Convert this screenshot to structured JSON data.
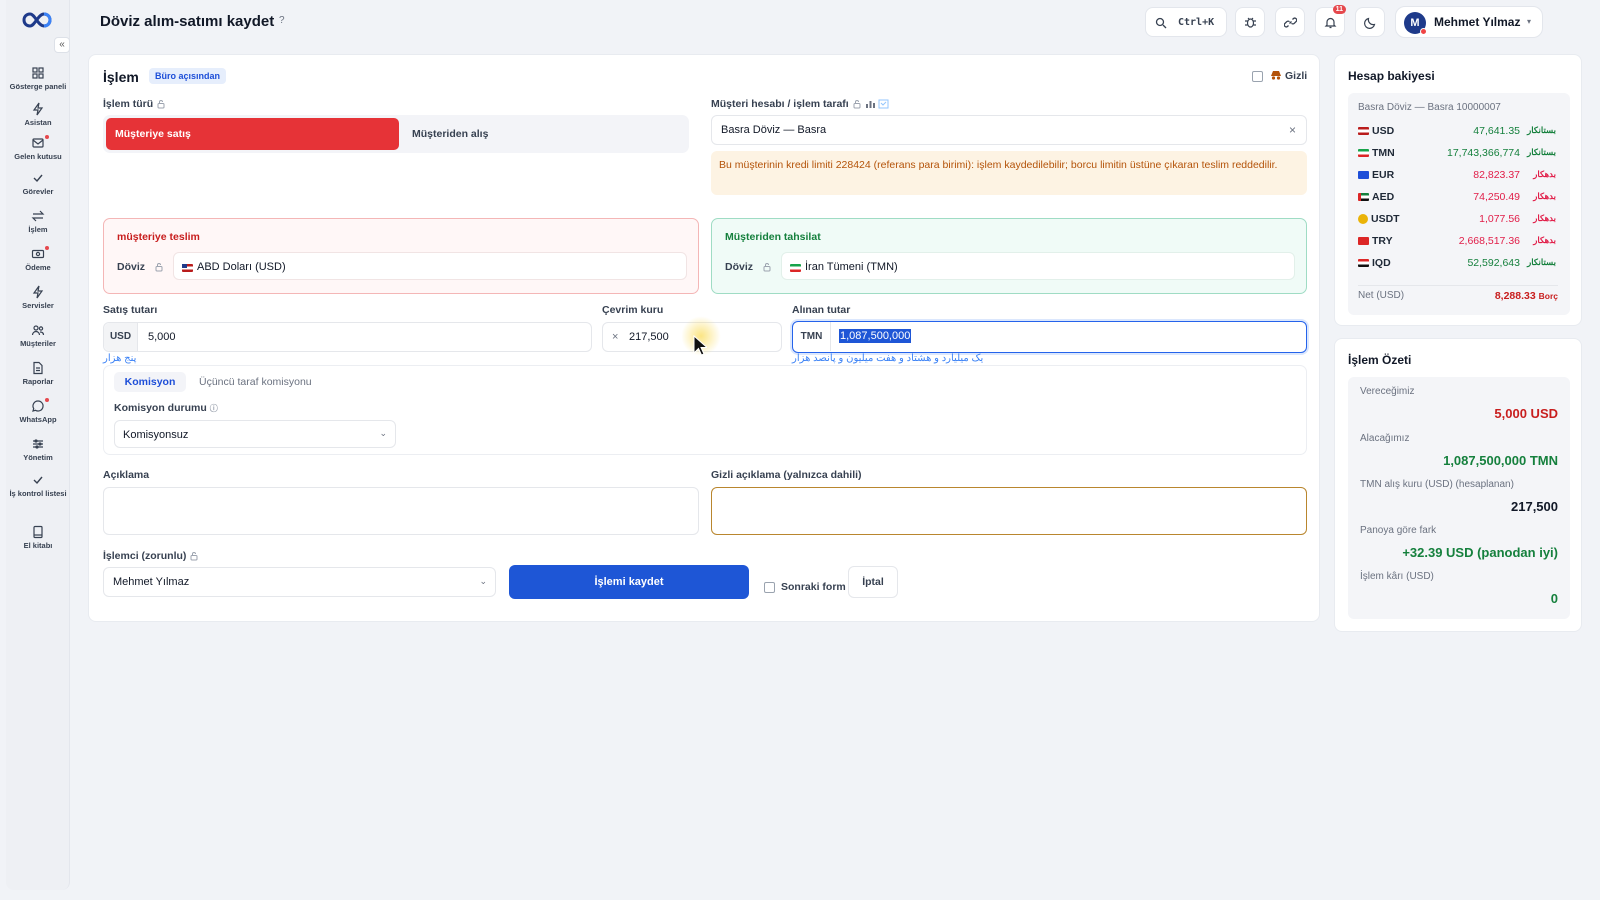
{
  "header": {
    "title": "Döviz alım-satımı kaydet",
    "info_icon": "?",
    "search_shortcut": "Ctrl+K",
    "notifications_count": "11",
    "user_name": "Mehmet Yılmaz",
    "user_initial": "M"
  },
  "sidebar": {
    "collapse": "«",
    "items": [
      {
        "label": "Gösterge paneli",
        "icon": "grid-icon"
      },
      {
        "label": "Asistan",
        "icon": "bolt-icon"
      },
      {
        "label": "Gelen kutusu",
        "icon": "inbox-icon"
      },
      {
        "label": "Görevler",
        "icon": "check-icon"
      },
      {
        "label": "İşlem",
        "icon": "swap-icon"
      },
      {
        "label": "Ödeme",
        "icon": "cash-icon"
      },
      {
        "label": "Servisler",
        "icon": "bolt-icon"
      },
      {
        "label": "Müşteriler",
        "icon": "users-icon"
      },
      {
        "label": "Raporlar",
        "icon": "file-icon"
      },
      {
        "label": "WhatsApp",
        "icon": "chat-icon"
      },
      {
        "label": "Yönetim",
        "icon": "sliders-icon"
      },
      {
        "label": "İş kontrol listesi",
        "icon": "check-icon"
      },
      {
        "label": "El kitabı",
        "icon": "book-icon"
      }
    ]
  },
  "form": {
    "title": "İşlem",
    "perspective_tag": "Büro açısından",
    "hidden_label": "Gizli",
    "type_label": "İşlem türü",
    "type_options": [
      "Müşteriye satış",
      "Müşteriden alış"
    ],
    "account_label": "Müşteri hesabı / işlem tarafı",
    "account_value": "Basra Döviz — Basra",
    "credit_warning": "Bu müşterinin kredi limiti 228424 (referans para birimi): işlem kaydedilebilir; borcu limitin üstüne çıkaran teslim reddedilir.",
    "delivery": {
      "title": "müşteriye teslim",
      "currency_label": "Döviz",
      "currency": "ABD Doları (USD)"
    },
    "collection": {
      "title": "Müşteriden tahsilat",
      "currency_label": "Döviz",
      "currency": "İran Tümeni (TMN)"
    },
    "sale_amount_label": "Satış tutarı",
    "sale_currency": "USD",
    "sale_amount": "5,000",
    "sale_words": "پنج هزار",
    "rate_label": "Çevrim kuru",
    "rate_prefix": "×",
    "rate": "217,500",
    "received_label": "Alınan tutar",
    "received_currency": "TMN",
    "received_amount": "1,087,500,000",
    "received_words": "یک میلیارد و هشتاد و هفت میلیون و پانصد هزار",
    "commission_tabs": [
      "Komisyon",
      "Üçüncü taraf komisyonu"
    ],
    "commission_status_label": "Komisyon durumu",
    "commission_status": "Komisyonsuz",
    "description_label": "Açıklama",
    "private_description_label": "Gizli açıklama (yalnızca dahili)",
    "operator_label": "İşlemci (zorunlu)",
    "operator_value": "Mehmet Yılmaz",
    "save_button": "İşlemi kaydet",
    "next_form_label": "Sonraki form",
    "cancel_button": "İptal"
  },
  "balance": {
    "title": "Hesap bakiyesi",
    "account": "Basra Döviz — Basra 10000007",
    "rows": [
      {
        "code": "USD",
        "value": "47,641.35",
        "status": "بستانکار",
        "positive": true
      },
      {
        "code": "TMN",
        "value": "17,743,366,774",
        "status": "بستانکار",
        "positive": true
      },
      {
        "code": "EUR",
        "value": "82,823.37",
        "status": "بدهکار",
        "positive": false
      },
      {
        "code": "AED",
        "value": "74,250.49",
        "status": "بدهکار",
        "positive": false
      },
      {
        "code": "USDT",
        "value": "1,077.56",
        "status": "بدهکار",
        "positive": false
      },
      {
        "code": "TRY",
        "value": "2,668,517.36",
        "status": "بدهکار",
        "positive": false
      },
      {
        "code": "IQD",
        "value": "52,592,643",
        "status": "بستانکار",
        "positive": true
      }
    ],
    "net_label": "Net (USD)",
    "net_value": "8,288.33",
    "net_status": "Borç"
  },
  "summary": {
    "title": "İşlem Özeti",
    "rows": [
      {
        "label": "Vereceğimiz",
        "value": "5,000 USD",
        "color": "#c81e1e"
      },
      {
        "label": "Alacağımız",
        "value": "1,087,500,000 TMN",
        "color": "#15803d"
      },
      {
        "label": "TMN alış kuru (USD) (hesaplanan)",
        "value": "217,500",
        "color": "#111827"
      },
      {
        "label": "Panoya göre fark",
        "value": "+32.39 USD (panodan iyi)",
        "color": "#15803d"
      },
      {
        "label": "İşlem kârı (USD)",
        "value": "0",
        "color": "#15803d"
      }
    ]
  },
  "colors": {
    "accent": "#1e56d6",
    "sell": "#e63337",
    "positive": "#15803d",
    "negative": "#e11d48"
  }
}
